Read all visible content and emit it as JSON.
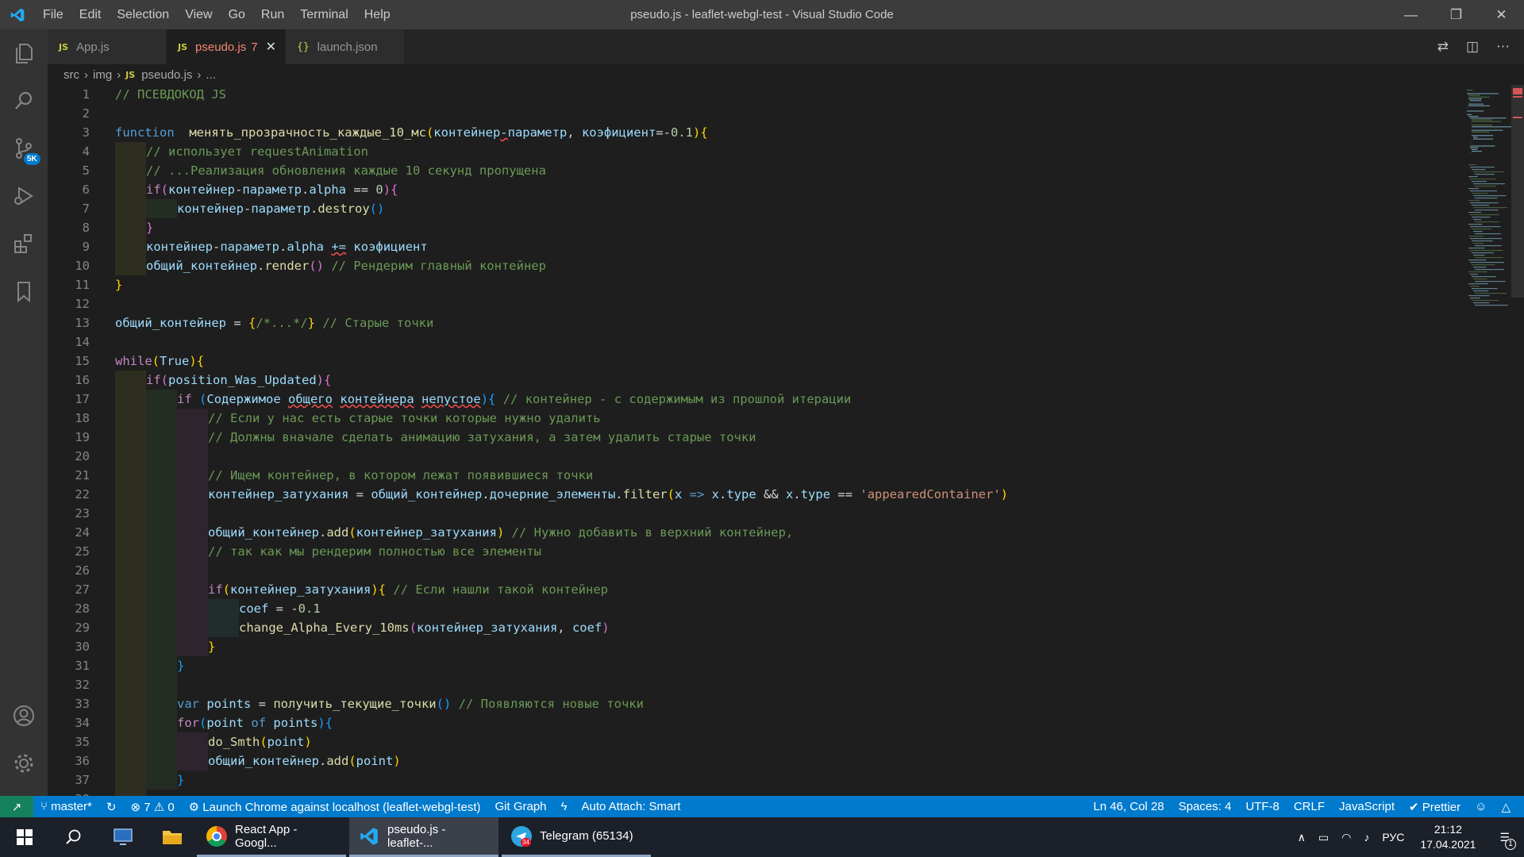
{
  "window": {
    "title": "pseudo.js - leaflet-webgl-test - Visual Studio Code",
    "menu": [
      "File",
      "Edit",
      "Selection",
      "View",
      "Go",
      "Run",
      "Terminal",
      "Help"
    ]
  },
  "activity_badge": "5K",
  "tabs": [
    {
      "icon": "JS",
      "label": "App.js",
      "active": false
    },
    {
      "icon": "JS",
      "label": "pseudo.js",
      "count": "7",
      "active": true
    },
    {
      "icon": "{}",
      "label": "launch.json",
      "active": false
    }
  ],
  "breadcrumb": {
    "parts": [
      "src",
      "img"
    ],
    "file_icon": "JS",
    "file": "pseudo.js",
    "tail": "..."
  },
  "colors": {
    "keyword": "#569cd6",
    "control": "#c586c0",
    "function": "#dcdcaa",
    "variable": "#9cdcfe",
    "comment": "#6a9955",
    "string": "#ce9178",
    "number": "#b5cea8",
    "bracket1": "#ffd700",
    "bracket2": "#da70d6",
    "bracket3": "#179fff",
    "statusbar": "#007acc",
    "remote": "#16825d"
  },
  "code_lines": [
    {
      "n": "1",
      "indent": 0,
      "tokens": [
        [
          "cm",
          "// ПСЕВДОКОД JS"
        ]
      ]
    },
    {
      "n": "2",
      "indent": 0,
      "tokens": []
    },
    {
      "n": "3",
      "indent": 0,
      "tokens": [
        [
          "kw",
          "function"
        ],
        [
          "",
          "  "
        ],
        [
          "fn",
          "менять_прозрачность_каждые_10_мс"
        ],
        [
          "b1",
          "("
        ],
        [
          "vr",
          "контейнер"
        ],
        [
          "sq",
          "-"
        ],
        [
          "vr",
          "параметр"
        ],
        [
          "",
          ", "
        ],
        [
          "vr",
          "коэфициент"
        ],
        [
          "",
          "=-"
        ],
        [
          "nm",
          "0.1"
        ],
        [
          "b1",
          ")"
        ],
        [
          "b1",
          "{"
        ]
      ]
    },
    {
      "n": "4",
      "indent": 1,
      "tokens": [
        [
          "cm",
          "// использует requestAnimation"
        ]
      ]
    },
    {
      "n": "5",
      "indent": 1,
      "tokens": [
        [
          "cm",
          "// ...Реализация обновления каждые 10 секунд пропущена"
        ]
      ]
    },
    {
      "n": "6",
      "indent": 1,
      "tokens": [
        [
          "fl",
          "if"
        ],
        [
          "b2",
          "("
        ],
        [
          "vr",
          "контейнер"
        ],
        [
          "",
          "-"
        ],
        [
          "vr",
          "параметр"
        ],
        [
          "",
          "."
        ],
        [
          "vr",
          "alpha"
        ],
        [
          "",
          " == "
        ],
        [
          "nm",
          "0"
        ],
        [
          "b2",
          ")"
        ],
        [
          "b2",
          "{"
        ]
      ]
    },
    {
      "n": "7",
      "indent": 2,
      "tokens": [
        [
          "vr",
          "контейнер"
        ],
        [
          "",
          "-"
        ],
        [
          "vr",
          "параметр"
        ],
        [
          "",
          "."
        ],
        [
          "fn",
          "destroy"
        ],
        [
          "b3",
          "()"
        ]
      ]
    },
    {
      "n": "8",
      "indent": 1,
      "tokens": [
        [
          "b2",
          "}"
        ]
      ]
    },
    {
      "n": "9",
      "indent": 1,
      "tokens": [
        [
          "vr",
          "контейнер"
        ],
        [
          "",
          "-"
        ],
        [
          "vr",
          "параметр"
        ],
        [
          "",
          "."
        ],
        [
          "vr",
          "alpha"
        ],
        [
          "",
          " "
        ],
        [
          "sq",
          "+="
        ],
        [
          "",
          " "
        ],
        [
          "vr",
          "коэфициент"
        ]
      ]
    },
    {
      "n": "10",
      "indent": 1,
      "tokens": [
        [
          "vr",
          "общий_контейнер"
        ],
        [
          "",
          "."
        ],
        [
          "fn",
          "render"
        ],
        [
          "b2",
          "()"
        ],
        [
          "",
          " "
        ],
        [
          "cm",
          "// Рендерим главный контейнер"
        ]
      ]
    },
    {
      "n": "11",
      "indent": 0,
      "tokens": [
        [
          "b1",
          "}"
        ]
      ]
    },
    {
      "n": "12",
      "indent": 0,
      "tokens": []
    },
    {
      "n": "13",
      "indent": 0,
      "tokens": [
        [
          "vr",
          "общий_контейнер"
        ],
        [
          "",
          " = "
        ],
        [
          "b1",
          "{"
        ],
        [
          "cm",
          "/*...*/"
        ],
        [
          "b1",
          "}"
        ],
        [
          "",
          " "
        ],
        [
          "cm",
          "// Старые точки"
        ]
      ]
    },
    {
      "n": "14",
      "indent": 0,
      "tokens": []
    },
    {
      "n": "15",
      "indent": 0,
      "tokens": [
        [
          "fl",
          "while"
        ],
        [
          "b1",
          "("
        ],
        [
          "vr",
          "True"
        ],
        [
          "b1",
          ")"
        ],
        [
          "b1",
          "{"
        ]
      ]
    },
    {
      "n": "16",
      "indent": 1,
      "tokens": [
        [
          "fl",
          "if"
        ],
        [
          "b2",
          "("
        ],
        [
          "vr",
          "position_Was_Updated"
        ],
        [
          "b2",
          ")"
        ],
        [
          "b2",
          "{"
        ]
      ]
    },
    {
      "n": "17",
      "indent": 2,
      "tokens": [
        [
          "fl",
          "if"
        ],
        [
          "",
          " "
        ],
        [
          "b3",
          "("
        ],
        [
          "vr",
          "Содержимое "
        ],
        [
          "sq",
          "общего"
        ],
        [
          "",
          " "
        ],
        [
          "sq",
          "контейнера"
        ],
        [
          "",
          " "
        ],
        [
          "sq",
          "непустое"
        ],
        [
          "b3",
          ")"
        ],
        [
          "b3",
          "{"
        ],
        [
          "",
          " "
        ],
        [
          "cm",
          "// контейнер - с содержимым из прошлой итерации"
        ]
      ]
    },
    {
      "n": "18",
      "indent": 3,
      "tokens": [
        [
          "cm",
          "// Если у нас есть старые точки которые нужно удалить"
        ]
      ]
    },
    {
      "n": "19",
      "indent": 3,
      "tokens": [
        [
          "cm",
          "// Должны вначале сделать анимацию затухания, а затем удалить старые точки"
        ]
      ]
    },
    {
      "n": "20",
      "indent": 3,
      "tokens": []
    },
    {
      "n": "21",
      "indent": 3,
      "tokens": [
        [
          "cm",
          "// Ищем контейнер, в котором лежат появившиеся точки"
        ]
      ]
    },
    {
      "n": "22",
      "indent": 3,
      "tokens": [
        [
          "vr",
          "контейнер_затухания"
        ],
        [
          "",
          " = "
        ],
        [
          "vr",
          "общий_контейнер"
        ],
        [
          "",
          "."
        ],
        [
          "vr",
          "дочерние_элементы"
        ],
        [
          "",
          "."
        ],
        [
          "fn",
          "filter"
        ],
        [
          "b1",
          "("
        ],
        [
          "vr",
          "x"
        ],
        [
          "",
          " "
        ],
        [
          "kw",
          "=>"
        ],
        [
          "",
          " "
        ],
        [
          "vr",
          "x"
        ],
        [
          "",
          "."
        ],
        [
          "vr",
          "type"
        ],
        [
          "",
          " && "
        ],
        [
          "vr",
          "x"
        ],
        [
          "",
          "."
        ],
        [
          "vr",
          "type"
        ],
        [
          "",
          " == "
        ],
        [
          "st",
          "'appearedContainer'"
        ],
        [
          "b1",
          ")"
        ]
      ]
    },
    {
      "n": "23",
      "indent": 3,
      "tokens": []
    },
    {
      "n": "24",
      "indent": 3,
      "tokens": [
        [
          "vr",
          "общий_контейнер"
        ],
        [
          "",
          "."
        ],
        [
          "fn",
          "add"
        ],
        [
          "b1",
          "("
        ],
        [
          "vr",
          "контейнер_затухания"
        ],
        [
          "b1",
          ")"
        ],
        [
          "",
          " "
        ],
        [
          "cm",
          "// Нужно добавить в верхний контейнер,"
        ]
      ]
    },
    {
      "n": "25",
      "indent": 3,
      "tokens": [
        [
          "cm",
          "// так как мы рендерим полностью все элементы"
        ]
      ]
    },
    {
      "n": "26",
      "indent": 3,
      "tokens": []
    },
    {
      "n": "27",
      "indent": 3,
      "tokens": [
        [
          "fl",
          "if"
        ],
        [
          "b1",
          "("
        ],
        [
          "vr",
          "контейнер_затухания"
        ],
        [
          "b1",
          ")"
        ],
        [
          "b1",
          "{"
        ],
        [
          "",
          " "
        ],
        [
          "cm",
          "// Если нашли такой контейнер"
        ]
      ]
    },
    {
      "n": "28",
      "indent": 4,
      "tokens": [
        [
          "vr",
          "coef"
        ],
        [
          "",
          " = -"
        ],
        [
          "nm",
          "0.1"
        ]
      ]
    },
    {
      "n": "29",
      "indent": 4,
      "tokens": [
        [
          "fn",
          "change_Alpha_Every_10ms"
        ],
        [
          "b2",
          "("
        ],
        [
          "vr",
          "контейнер_затухания"
        ],
        [
          "",
          ", "
        ],
        [
          "vr",
          "coef"
        ],
        [
          "b2",
          ")"
        ]
      ]
    },
    {
      "n": "30",
      "indent": 3,
      "tokens": [
        [
          "b1",
          "}"
        ]
      ]
    },
    {
      "n": "31",
      "indent": 2,
      "tokens": [
        [
          "b3",
          "}"
        ]
      ]
    },
    {
      "n": "32",
      "indent": 2,
      "tokens": []
    },
    {
      "n": "33",
      "indent": 2,
      "tokens": [
        [
          "kw",
          "var"
        ],
        [
          "",
          " "
        ],
        [
          "vr",
          "points"
        ],
        [
          "",
          " = "
        ],
        [
          "fn",
          "получить_текущие_точки"
        ],
        [
          "b3",
          "()"
        ],
        [
          "",
          " "
        ],
        [
          "cm",
          "// Появляются новые точки"
        ]
      ]
    },
    {
      "n": "34",
      "indent": 2,
      "tokens": [
        [
          "fl",
          "for"
        ],
        [
          "b3",
          "("
        ],
        [
          "vr",
          "point"
        ],
        [
          "",
          " "
        ],
        [
          "kw",
          "of"
        ],
        [
          "",
          " "
        ],
        [
          "vr",
          "points"
        ],
        [
          "b3",
          ")"
        ],
        [
          "b3",
          "{"
        ]
      ]
    },
    {
      "n": "35",
      "indent": 3,
      "tokens": [
        [
          "fn",
          "do_Smth"
        ],
        [
          "b1",
          "("
        ],
        [
          "vr",
          "point"
        ],
        [
          "b1",
          ")"
        ]
      ]
    },
    {
      "n": "36",
      "indent": 3,
      "tokens": [
        [
          "vr",
          "общий_контейнер"
        ],
        [
          "",
          "."
        ],
        [
          "fn",
          "add"
        ],
        [
          "b1",
          "("
        ],
        [
          "vr",
          "point"
        ],
        [
          "b1",
          ")"
        ]
      ]
    },
    {
      "n": "37",
      "indent": 2,
      "tokens": [
        [
          "b3",
          "}"
        ]
      ]
    },
    {
      "n": "38",
      "indent": 1,
      "tokens": []
    }
  ],
  "statusbar": {
    "branch": "master*",
    "errors": "7",
    "warnings": "0",
    "launch": "Launch Chrome against localhost (leaflet-webgl-test)",
    "git_graph": "Git Graph",
    "auto_attach": "Auto Attach: Smart",
    "position": "Ln 46, Col 28",
    "spaces": "Spaces: 4",
    "encoding": "UTF-8",
    "eol": "CRLF",
    "language": "JavaScript",
    "prettier": "Prettier"
  },
  "taskbar": {
    "apps": [
      {
        "label": "React App - Googl...",
        "icon": "chrome-icon",
        "active": false
      },
      {
        "label": "pseudo.js - leaflet-...",
        "icon": "vscode-icon",
        "active": true
      },
      {
        "label": "Telegram (65134)",
        "icon": "telegram-icon",
        "badge": "34",
        "active": false
      }
    ],
    "lang": "РУС",
    "time": "21:12",
    "date": "17.04.2021",
    "notif_count": "1"
  }
}
